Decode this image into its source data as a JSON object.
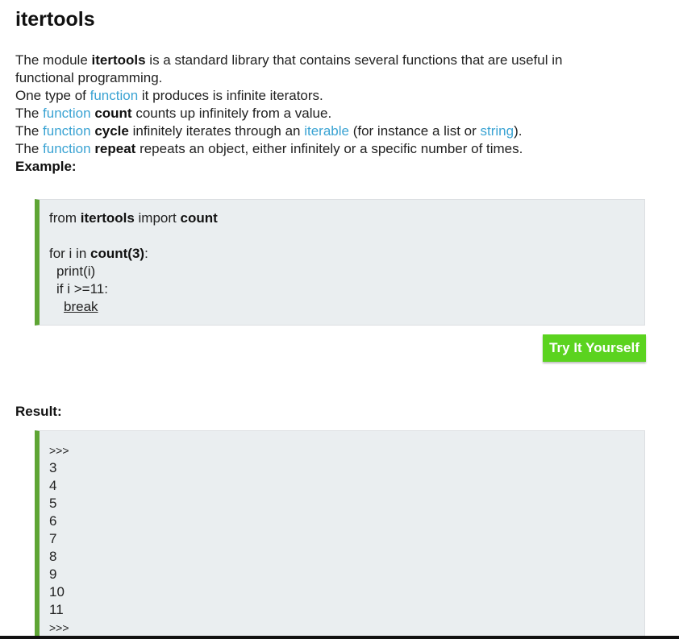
{
  "title": "itertools",
  "description": {
    "l1_a": "The module ",
    "l1_b": "itertools",
    "l1_c": " is a standard library that contains several functions that are useful in",
    "l2": "functional programming.",
    "l3_a": "One type of ",
    "l3_link": "function",
    "l3_b": " it produces is infinite iterators.",
    "l4_a": "The ",
    "l4_link": "function",
    "l4_bold": "count",
    "l4_b": " counts up infinitely from a value.",
    "l5_a": "The ",
    "l5_link": "function",
    "l5_bold": "cycle",
    "l5_b": " infinitely iterates through an ",
    "l5_link2": "iterable",
    "l5_c": " (for instance a list or ",
    "l5_link3": "string",
    "l5_d": ").",
    "l6_a": "The ",
    "l6_link": "function",
    "l6_bold": "repeat",
    "l6_b": " repeats an object, either infinitely or a specific number of times.",
    "example_label": "Example:"
  },
  "code": {
    "l1_a": "from ",
    "l1_b": "itertools",
    "l1_c": " import ",
    "l1_d": "count",
    "l2_a": "for i in ",
    "l2_b": "count(3)",
    "l2_c": ":",
    "l3": "print(i)",
    "l4": "if i >=11:",
    "l5": "break"
  },
  "try_button": "Try It Yourself",
  "result_label": "Result:",
  "result_lines": [
    ">>>",
    "3",
    "4",
    "5",
    "6",
    "7",
    "8",
    "9",
    "10",
    "11",
    ">>>"
  ],
  "colors": {
    "link": "#3aa3d3",
    "accent_bar": "#5ea534",
    "button": "#5bd31f",
    "code_bg": "#eaeef0"
  }
}
